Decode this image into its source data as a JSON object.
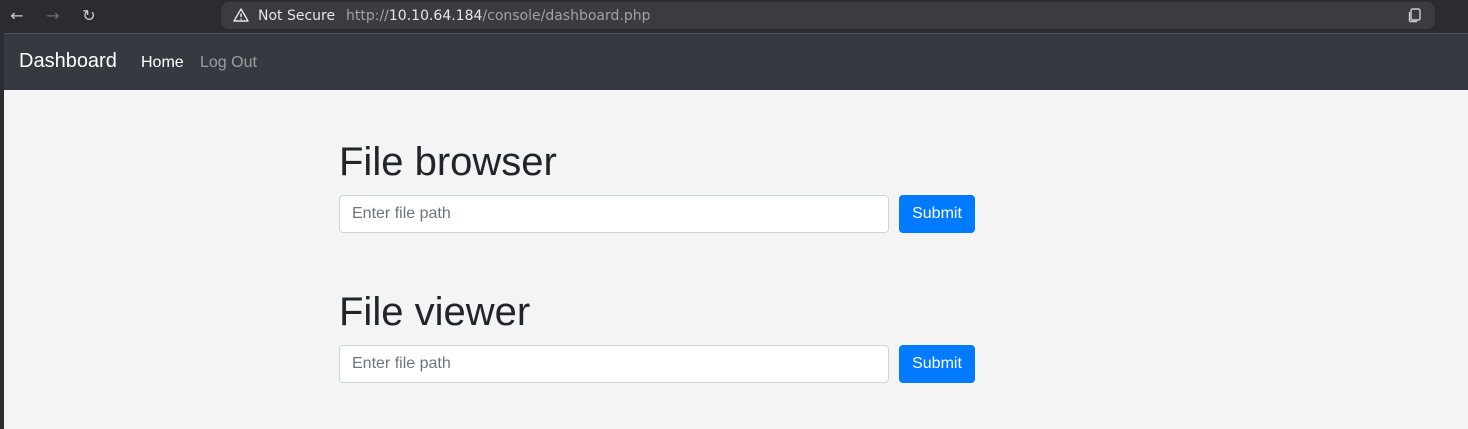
{
  "browser": {
    "back_icon": "←",
    "forward_icon": "→",
    "reload_icon": "↻",
    "security_label": "Not Secure",
    "url_scheme": "http://",
    "url_host": "10.10.64.184",
    "url_path": "/console/dashboard.php"
  },
  "navbar": {
    "brand": "Dashboard",
    "links": [
      {
        "label": "Home",
        "active": true
      },
      {
        "label": "Log Out",
        "active": false
      }
    ]
  },
  "main": {
    "file_browser": {
      "title": "File browser",
      "input_value": "",
      "input_placeholder": "Enter file path",
      "submit_label": "Submit"
    },
    "file_viewer": {
      "title": "File viewer",
      "input_value": "",
      "input_placeholder": "Enter file path",
      "submit_label": "Submit"
    }
  },
  "colors": {
    "navbar_bg": "#343a40",
    "page_bg": "#f4f4f4",
    "primary": "#007bff"
  }
}
